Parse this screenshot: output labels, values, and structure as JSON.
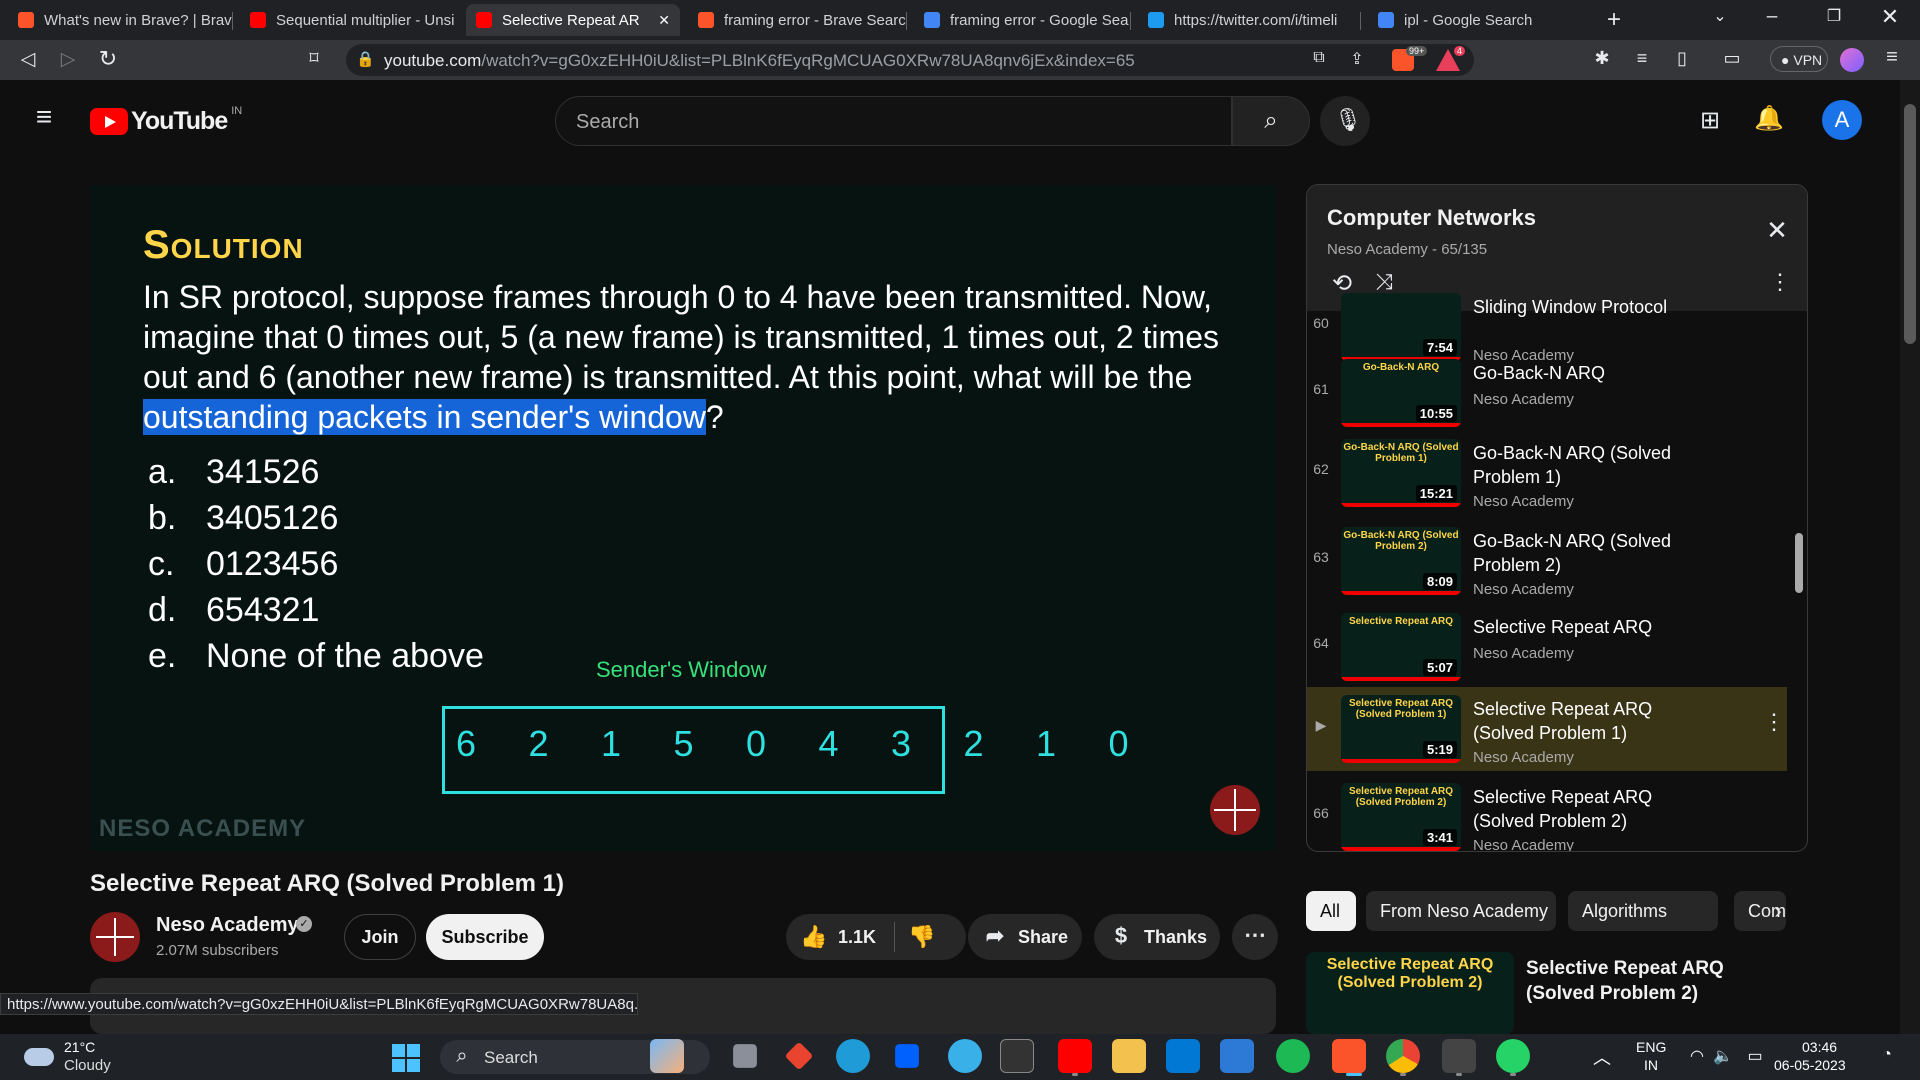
{
  "browser": {
    "tabs": [
      {
        "title": "What's new in Brave? | Brav",
        "color": "#fb542b"
      },
      {
        "title": "Sequential multiplier - Unsi",
        "color": "#ff0000"
      },
      {
        "title": "Selective Repeat AR",
        "color": "#ff0000",
        "active": true
      },
      {
        "title": "framing error - Brave Searc",
        "color": "#fb542b"
      },
      {
        "title": "framing error - Google Sea",
        "color": "#4285f4"
      },
      {
        "title": "https://twitter.com/i/timeli",
        "color": "#1d9bf0"
      },
      {
        "title": "ipl - Google Search",
        "color": "#4285f4"
      }
    ],
    "url_host": "youtube.com",
    "url_path": "/watch?v=gG0xzEHH0iU&list=PLBlnK6fEyqRgMCUAG0XRw78UA8qnv6jEx&index=65",
    "shield_count": "99+",
    "rewards_count": "4",
    "vpn_label": "VPN"
  },
  "youtube": {
    "logo_text": "YouTube",
    "country": "IN",
    "search_placeholder": "Search",
    "avatar_letter": "A"
  },
  "slide": {
    "title": "Solution",
    "question_pre": "In SR protocol, suppose frames through 0 to 4 have been transmitted. Now, imagine that 0 times out, 5 (a new frame) is transmitted, 1 times out, 2 times out and 6 (another new frame) is transmitted. At this point, what will be the ",
    "question_hl": "outstanding packets in sender's window",
    "question_post": "?",
    "options": [
      {
        "letter": "a.",
        "text": "341526"
      },
      {
        "letter": "b.",
        "text": "3405126"
      },
      {
        "letter": "c.",
        "text": "0123456"
      },
      {
        "letter": "d.",
        "text": "654321"
      },
      {
        "letter": "e.",
        "text": "None of the above"
      }
    ],
    "window_label": "Sender's Window",
    "window_numbers": [
      "6",
      "2",
      "1",
      "5",
      "0",
      "4",
      "3",
      "2",
      "1",
      "0"
    ],
    "watermark": "NESO ACADEMY"
  },
  "video_info": {
    "title": "Selective Repeat ARQ (Solved Problem 1)",
    "channel": "Neso Academy",
    "subscribers": "2.07M subscribers",
    "join": "Join",
    "subscribe": "Subscribe",
    "likes": "1.1K",
    "share": "Share",
    "thanks": "Thanks"
  },
  "playlist": {
    "title": "Computer Networks",
    "meta": "Neso Academy - 65/135",
    "items": [
      {
        "num": "60",
        "thumb": "",
        "duration": "7:54",
        "title": "Sliding Window Protocol",
        "channel": "Neso Academy"
      },
      {
        "num": "61",
        "thumb": "Go-Back-N ARQ",
        "duration": "10:55",
        "title": "Go-Back-N ARQ",
        "channel": "Neso Academy"
      },
      {
        "num": "62",
        "thumb": "Go-Back-N ARQ (Solved Problem 1)",
        "duration": "15:21",
        "title": "Go-Back-N ARQ (Solved Problem 1)",
        "channel": "Neso Academy"
      },
      {
        "num": "63",
        "thumb": "Go-Back-N ARQ (Solved Problem 2)",
        "duration": "8:09",
        "title": "Go-Back-N ARQ (Solved Problem 2)",
        "channel": "Neso Academy"
      },
      {
        "num": "64",
        "thumb": "Selective Repeat ARQ",
        "duration": "5:07",
        "title": "Selective Repeat ARQ",
        "channel": "Neso Academy"
      },
      {
        "num": "▶",
        "thumb": "Selective Repeat ARQ (Solved Problem 1)",
        "duration": "5:19",
        "title": "Selective Repeat ARQ (Solved Problem 1)",
        "channel": "Neso Academy",
        "current": true
      },
      {
        "num": "66",
        "thumb": "Selective Repeat ARQ (Solved Problem 2)",
        "duration": "3:41",
        "title": "Selective Repeat ARQ (Solved Problem 2)",
        "channel": "Neso Academy"
      }
    ]
  },
  "chips": [
    "All",
    "From Neso Academy",
    "Algorithms",
    "Com"
  ],
  "recommended": {
    "thumb": "Selective Repeat ARQ (Solved Problem 2)",
    "title": "Selective Repeat ARQ (Solved Problem 2)",
    "channel": "Neso Academy"
  },
  "status_url": "https://www.youtube.com/watch?v=gG0xzEHH0iU&list=PLBlnK6fEyqRgMCUAG0XRw78UA8q...",
  "taskbar": {
    "temp": "21°C",
    "weather": "Cloudy",
    "search": "Search",
    "lang1": "ENG",
    "lang2": "IN",
    "time": "03:46",
    "date": "06-05-2023"
  }
}
